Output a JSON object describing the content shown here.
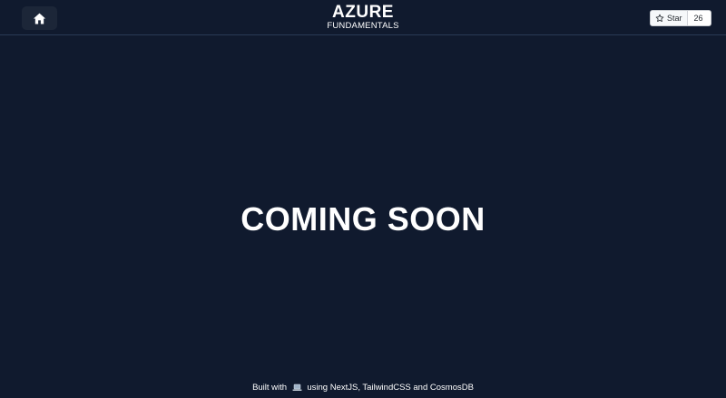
{
  "header": {
    "home_icon": "home-icon",
    "brand": {
      "title": "AZURE",
      "subtitle": "FUNDAMENTALS"
    },
    "github_star": {
      "icon": "star-icon",
      "label": "Star",
      "count": "26"
    }
  },
  "main": {
    "message": "COMING SOON"
  },
  "footer": {
    "prefix": "Built with",
    "icon": "laptop-icon",
    "suffix": "using NextJS, TailwindCSS and CosmosDB"
  },
  "colors": {
    "background": "#101a2e",
    "header_border": "#2a3a55",
    "home_button_bg": "#1c2638",
    "text": "#ffffff"
  }
}
